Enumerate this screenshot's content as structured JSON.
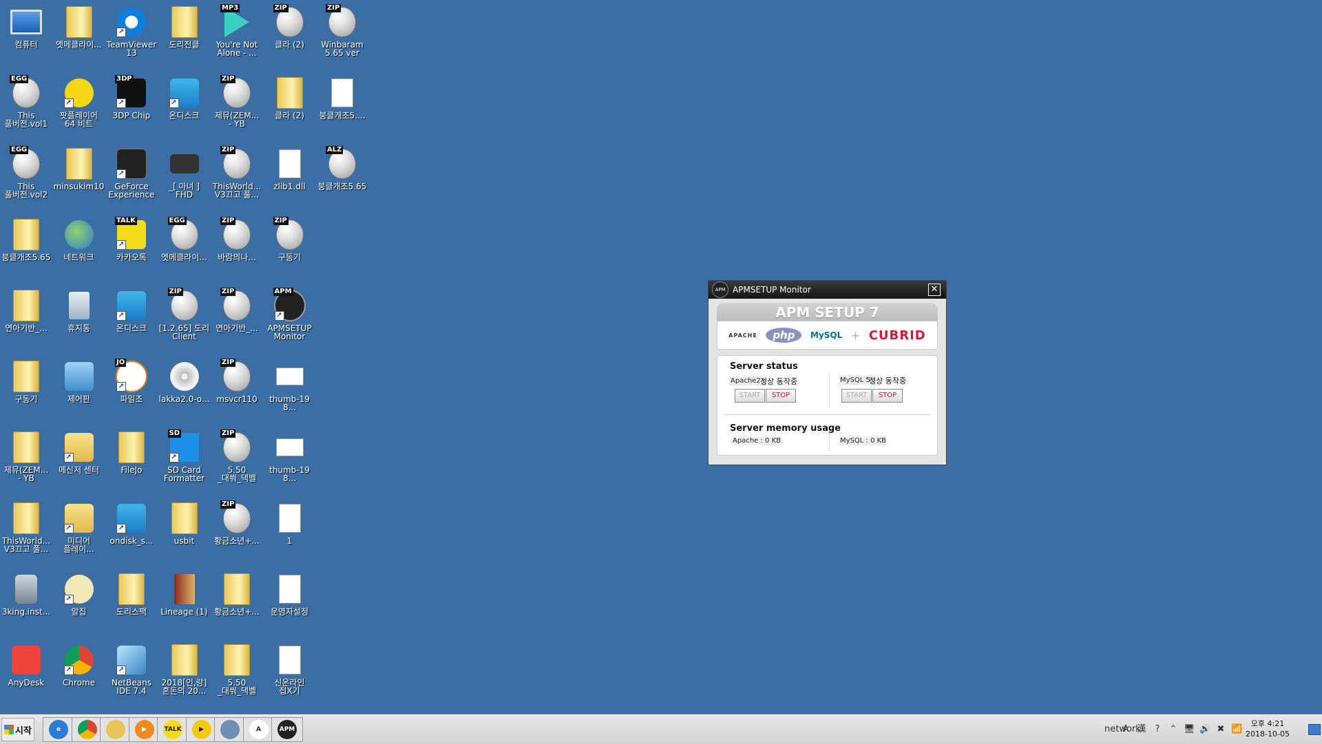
{
  "desktop": {
    "icons": [
      {
        "label": "컴퓨터",
        "glyph": "computer-icon",
        "style": "monitor",
        "shortcut": false
      },
      {
        "label": "엣메클라이...",
        "glyph": "folder-icon",
        "style": "folder",
        "shortcut": false
      },
      {
        "label": "TeamViewer\n13",
        "glyph": "teamviewer-icon",
        "style": "teamviewer",
        "shortcut": true
      },
      {
        "label": "도리전클",
        "glyph": "folder-icon",
        "style": "folder",
        "shortcut": false
      },
      {
        "label": "You're Not\nAlone - ...",
        "glyph": "mp3-file-icon",
        "style": "mp3",
        "shortcut": false,
        "badge": "MP3"
      },
      {
        "label": "클라 (2)",
        "glyph": "zip-archive-icon",
        "style": "egg",
        "shortcut": false,
        "badge": "ZIP"
      },
      {
        "label": "Winbaram\n5.65 ver",
        "glyph": "zip-archive-icon",
        "style": "egg",
        "shortcut": false,
        "badge": "ZIP"
      },
      {
        "label": "This\n풀버전.vol1",
        "glyph": "egg-archive-icon",
        "style": "egg",
        "shortcut": false,
        "badge": "EGG"
      },
      {
        "label": "팟플레이어\n64 비트",
        "glyph": "potplayer-icon",
        "style": "potplayer",
        "shortcut": true
      },
      {
        "label": "3DP Chip",
        "glyph": "3dp-chip-icon",
        "style": "3dp",
        "shortcut": true,
        "badge": "3DP"
      },
      {
        "label": "온디스크",
        "glyph": "ondisk-icon",
        "style": "ondisk",
        "shortcut": true
      },
      {
        "label": "제뮤(ZEM...\n- YB",
        "glyph": "zip-archive-icon",
        "style": "egg",
        "shortcut": false,
        "badge": "ZIP"
      },
      {
        "label": "클라 (2)",
        "glyph": "folder-icon",
        "style": "folder",
        "shortcut": false
      },
      {
        "label": "붕클개조5....",
        "glyph": "document-icon",
        "style": "doc",
        "shortcut": false
      },
      {
        "label": "This\n풀버전.vol2",
        "glyph": "egg-archive-icon",
        "style": "egg",
        "shortcut": false,
        "badge": "EGG"
      },
      {
        "label": "minsukim10",
        "glyph": "user-folder-icon",
        "style": "folder",
        "shortcut": false
      },
      {
        "label": "GeForce\nExperience",
        "glyph": "geforce-icon",
        "style": "geforce",
        "shortcut": true
      },
      {
        "label": "_[ 마녀 ]\nFHD",
        "glyph": "video-file-icon",
        "style": "video",
        "shortcut": false
      },
      {
        "label": "ThisWorld...\nV3끄고 풀...",
        "glyph": "zip-archive-icon",
        "style": "egg",
        "shortcut": false,
        "badge": "ZIP"
      },
      {
        "label": "zlib1.dll",
        "glyph": "dll-file-icon",
        "style": "doc",
        "shortcut": false
      },
      {
        "label": "붕클개조5.65",
        "glyph": "alz-archive-icon",
        "style": "egg",
        "shortcut": false,
        "badge": "ALZ"
      },
      {
        "label": "붕클개조5.65",
        "glyph": "folder-icon",
        "style": "folder",
        "shortcut": false
      },
      {
        "label": "네트워크",
        "glyph": "network-icon",
        "style": "network",
        "shortcut": false
      },
      {
        "label": "카카오톡",
        "glyph": "kakaotalk-icon",
        "style": "kakao",
        "shortcut": true,
        "badge": "TALK"
      },
      {
        "label": "엣메클라이...",
        "glyph": "egg-archive-icon",
        "style": "egg",
        "shortcut": false,
        "badge": "EGG"
      },
      {
        "label": "바람의나...",
        "glyph": "zip-archive-icon",
        "style": "egg",
        "shortcut": false,
        "badge": "ZIP"
      },
      {
        "label": "구동기",
        "glyph": "zip-archive-icon",
        "style": "egg",
        "shortcut": false,
        "badge": "ZIP"
      },
      {
        "label": "연아기반_...",
        "glyph": "folder-icon",
        "style": "folder",
        "shortcut": false
      },
      {
        "label": "휴지통",
        "glyph": "recycle-bin-icon",
        "style": "bin",
        "shortcut": false
      },
      {
        "label": "온디스크",
        "glyph": "ondisk-icon",
        "style": "ondisk",
        "shortcut": true
      },
      {
        "label": "[1.2.65] 도리\nClient",
        "glyph": "zip-archive-icon",
        "style": "egg",
        "shortcut": false,
        "badge": "ZIP"
      },
      {
        "label": "연아기반_...",
        "glyph": "zip-archive-icon",
        "style": "egg",
        "shortcut": false,
        "badge": "ZIP"
      },
      {
        "label": "APMSETUP\nMonitor",
        "glyph": "apm-icon",
        "style": "apm",
        "shortcut": true,
        "badge": "APM"
      },
      {
        "label": "구동기",
        "glyph": "folder-icon",
        "style": "folder",
        "shortcut": false
      },
      {
        "label": "제어판",
        "glyph": "control-panel-icon",
        "style": "cpanel",
        "shortcut": false
      },
      {
        "label": "파일조",
        "glyph": "filejo-icon",
        "style": "filejo",
        "shortcut": true,
        "badge": "JO"
      },
      {
        "label": "lakka2.0-o...",
        "glyph": "disc-image-icon",
        "style": "disc",
        "shortcut": false
      },
      {
        "label": "msvcr110",
        "glyph": "zip-archive-icon",
        "style": "egg",
        "shortcut": false,
        "badge": "ZIP"
      },
      {
        "label": "thumb-198...",
        "glyph": "image-file-icon",
        "style": "thumb",
        "shortcut": false
      },
      {
        "label": "제뮤(ZEM...\n- YB",
        "glyph": "folder-icon",
        "style": "folder",
        "shortcut": false
      },
      {
        "label": "메신저 센터",
        "glyph": "messenger-center-icon",
        "style": "messenger",
        "shortcut": true
      },
      {
        "label": "FileJo",
        "glyph": "folder-icon",
        "style": "folder",
        "shortcut": false
      },
      {
        "label": "SD Card\nFormatter",
        "glyph": "sd-card-icon",
        "style": "sd",
        "shortcut": true,
        "badge": "SD"
      },
      {
        "label": "5.50\n_대쒀_댁벨",
        "glyph": "zip-archive-icon",
        "style": "egg",
        "shortcut": false,
        "badge": "ZIP"
      },
      {
        "label": "thumb-198...",
        "glyph": "image-file-icon",
        "style": "thumb",
        "shortcut": false
      },
      {
        "label": "ThisWorld...\nV3끄고 풀...",
        "glyph": "folder-icon",
        "style": "folder",
        "shortcut": false
      },
      {
        "label": "미디어\n플레이...",
        "glyph": "media-player-icon",
        "style": "messenger",
        "shortcut": true
      },
      {
        "label": "ondisk_s...",
        "glyph": "ondisk-icon",
        "style": "ondisk",
        "shortcut": true
      },
      {
        "label": "usbit",
        "glyph": "folder-icon",
        "style": "folder",
        "shortcut": false
      },
      {
        "label": "황금소년+...",
        "glyph": "zip-archive-icon",
        "style": "egg",
        "shortcut": false,
        "badge": "ZIP"
      },
      {
        "label": "1",
        "glyph": "text-document-icon",
        "style": "doc",
        "shortcut": false
      },
      {
        "label": "3king.inst...",
        "glyph": "installer-icon",
        "style": "installer",
        "shortcut": false
      },
      {
        "label": "알집",
        "glyph": "alzip-icon",
        "style": "alzip",
        "shortcut": true
      },
      {
        "label": "도리스팩",
        "glyph": "folder-icon",
        "style": "folder",
        "shortcut": false
      },
      {
        "label": "Lineage (1)",
        "glyph": "folder-icon",
        "style": "lineage",
        "shortcut": false
      },
      {
        "label": "황금소년+...",
        "glyph": "folder-icon",
        "style": "folder",
        "shortcut": false
      },
      {
        "label": "운영자설정",
        "glyph": "text-document-icon",
        "style": "doc",
        "shortcut": false
      },
      {
        "label": "AnyDesk",
        "glyph": "anydesk-icon",
        "style": "anydesk",
        "shortcut": false
      },
      {
        "label": "Chrome",
        "glyph": "chrome-icon",
        "style": "chrome",
        "shortcut": true
      },
      {
        "label": "NetBeans\nIDE 7.4",
        "glyph": "netbeans-icon",
        "style": "netbeans",
        "shortcut": true
      },
      {
        "label": "2018[인,랑]\n혼돈의 20...",
        "glyph": "folder-icon",
        "style": "folder",
        "shortcut": false
      },
      {
        "label": "5.50\n_대쒀_댁벨",
        "glyph": "folder-icon",
        "style": "folder",
        "shortcut": false
      },
      {
        "label": "신온라인\n접X기",
        "glyph": "settings-file-icon",
        "style": "doc",
        "shortcut": false
      }
    ]
  },
  "apm": {
    "window_title": "APMSETUP Monitor",
    "title_icon_text": "APM",
    "close_glyph": "✕",
    "product_title": "APM SETUP 7",
    "logos": {
      "apache": "APACHE",
      "php": "php",
      "mysql": "MySQL",
      "plus": "+",
      "cubrid": "CUBRID"
    },
    "server_status_title": "Server status",
    "apache": {
      "label": "Apache2 :",
      "status": "정상 동작중",
      "start_label": "START",
      "stop_label": "STOP"
    },
    "mysql": {
      "label": "MySQL 5 :",
      "status": "정상 동작중",
      "start_label": "START",
      "stop_label": "STOP"
    },
    "memory_title": "Server memory usage",
    "apache_memory": "Apache : 0 KB",
    "mysql_memory": "MySQL : 0 KB"
  },
  "taskbar": {
    "start_label": "시작",
    "items": [
      {
        "name": "internet-explorer",
        "text": "e",
        "color": "#2a7ad6"
      },
      {
        "name": "chrome",
        "text": "",
        "color": "conic"
      },
      {
        "name": "file-explorer",
        "text": "",
        "color": "#e8c45a"
      },
      {
        "name": "media-player",
        "text": "▶",
        "color": "#f08a1d"
      },
      {
        "name": "kakaotalk",
        "text": "TALK",
        "color": "#f5dc1a"
      },
      {
        "name": "potplayer",
        "text": "▶",
        "color": "#f6c812"
      },
      {
        "name": "image-viewer",
        "text": "",
        "color": "#6f8fb2"
      },
      {
        "name": "wordpad",
        "text": "A",
        "color": "#ffffff"
      },
      {
        "name": "apm-monitor",
        "text": "APM",
        "color": "#222222"
      }
    ],
    "tray_icons": [
      "network",
      "A",
      "漢",
      "?",
      "⌃",
      "🖥",
      "🔊",
      "✖",
      "📶"
    ],
    "clock_time": "오후 4:21",
    "clock_date": "2018-10-05"
  }
}
